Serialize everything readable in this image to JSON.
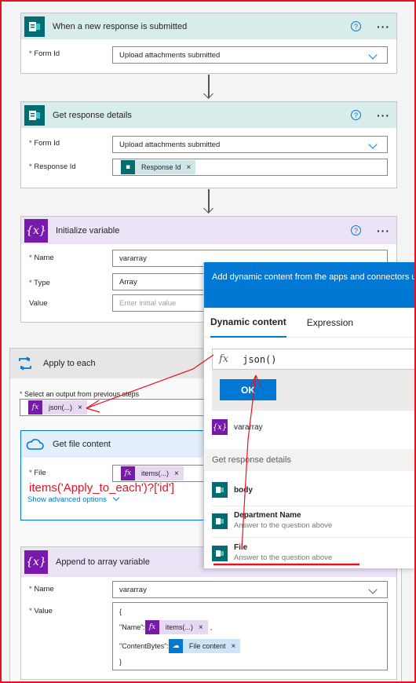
{
  "trigger": {
    "title": "When a new response is submitted",
    "form_id_label": "Form Id",
    "form_id_value": "Upload attachments submitted"
  },
  "get_details": {
    "title": "Get response details",
    "form_id_label": "Form Id",
    "form_id_value": "Upload attachments submitted",
    "response_id_label": "Response Id",
    "response_id_chip": "Response Id"
  },
  "init_var": {
    "title": "Initialize variable",
    "name_label": "Name",
    "name_value": "vararray",
    "type_label": "Type",
    "type_value": "Array",
    "value_label": "Value",
    "value_placeholder": "Enter initial value"
  },
  "apply_each": {
    "title": "Apply to each",
    "select_label": "Select an output from previous steps",
    "select_chip": "json(...)"
  },
  "get_file": {
    "title": "Get file content",
    "file_label": "File",
    "file_chip": "items(...)",
    "advanced": "Show advanced options"
  },
  "append": {
    "title": "Append to array variable",
    "name_label": "Name",
    "name_value": "vararray",
    "value_label": "Value",
    "line_open": "{",
    "name_key": "\"Name\":",
    "name_chip": "items(...)",
    "name_comma": ",",
    "content_key": "\"ContentBytes\":",
    "content_chip": "File content",
    "line_close": "}"
  },
  "annotation": {
    "expression_text": "items('Apply_to_each')?['id']"
  },
  "panel": {
    "header": "Add dynamic content from the apps and connectors used in this flow.",
    "tab_dynamic": "Dynamic content",
    "tab_expression": "Expression",
    "fx_symbol": "fx",
    "expression_value": "json()",
    "ok_label": "OK",
    "var_item": "vararray",
    "section_title": "Get response details",
    "items": [
      {
        "name": "body",
        "desc": ""
      },
      {
        "name": "Department Name",
        "desc": "Answer to the question above"
      },
      {
        "name": "File",
        "desc": "Answer to the question above"
      }
    ]
  },
  "icons": {
    "help": "help-circle-icon",
    "more": "more-dots-icon",
    "forms": "forms-icon",
    "variable": "variable-icon",
    "loop": "loop-icon",
    "onedrive": "onedrive-icon"
  },
  "colors": {
    "forms_header": "#d9ecec",
    "var_header": "#ece3f7",
    "brand_blue": "#0078d4",
    "annotation_red": "#e81123",
    "forms_icon": "#036c70",
    "var_icon": "#7719aa"
  }
}
